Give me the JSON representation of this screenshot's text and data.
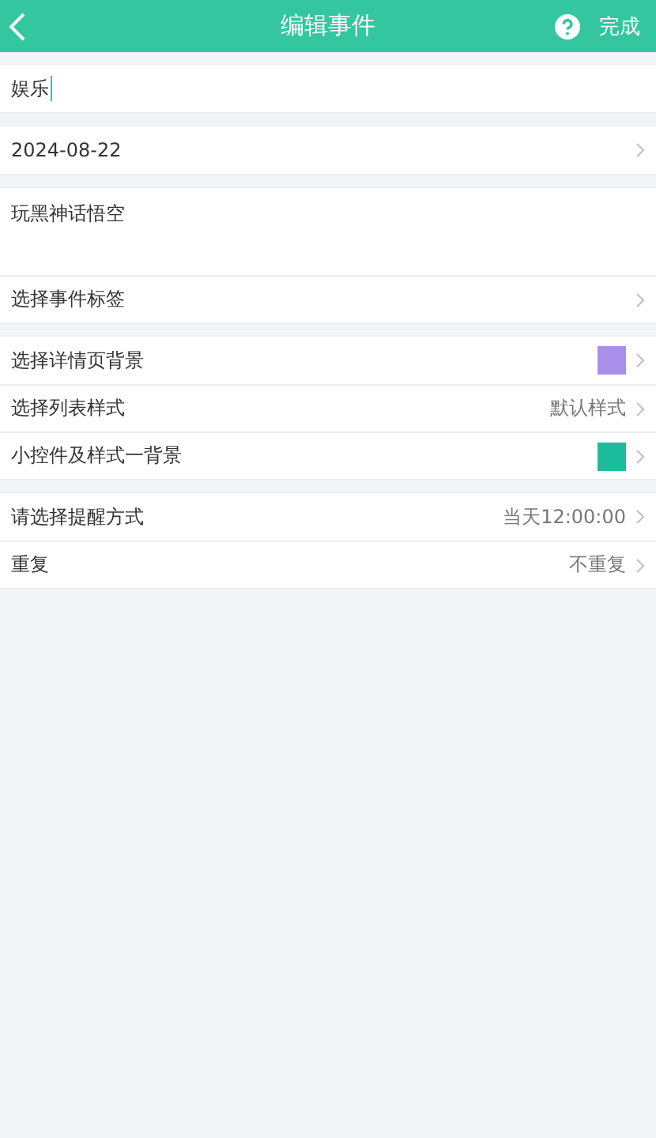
{
  "header": {
    "title": "编辑事件",
    "done": "完成"
  },
  "sections": [
    {
      "rows": [
        {
          "kind": "input",
          "value": "娱乐"
        }
      ]
    },
    {
      "rows": [
        {
          "kind": "nav",
          "label": "2024-08-22"
        }
      ]
    },
    {
      "rows": [
        {
          "kind": "note",
          "value": "玩黑神话悟空"
        },
        {
          "kind": "nav",
          "label": "选择事件标签"
        }
      ]
    },
    {
      "rows": [
        {
          "kind": "color",
          "label": "选择详情页背景",
          "color": "#a990ea"
        },
        {
          "kind": "nav",
          "label": "选择列表样式",
          "value": "默认样式"
        },
        {
          "kind": "color",
          "label": "小控件及样式一背景",
          "color": "#1abc9c"
        }
      ]
    },
    {
      "rows": [
        {
          "kind": "nav",
          "label": "请选择提醒方式",
          "value": "当天12:00:00"
        },
        {
          "kind": "nav",
          "label": "重复",
          "value": "不重复"
        }
      ]
    }
  ]
}
